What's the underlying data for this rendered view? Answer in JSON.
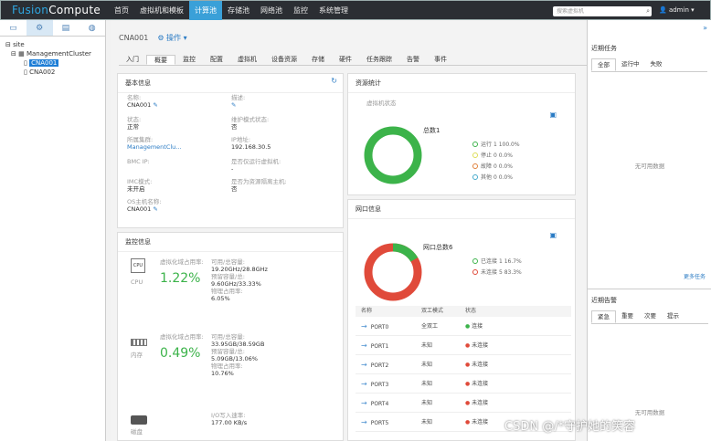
{
  "topbar": {
    "logo_a": "Fusion",
    "logo_b": "Compute",
    "nav": [
      "首页",
      "虚拟机和模板",
      "计算池",
      "存储池",
      "网络池",
      "监控",
      "系统管理"
    ],
    "active_nav": 2,
    "search_placeholder": "搜索虚拟机",
    "user": "admin"
  },
  "tree": {
    "root": "site",
    "cluster": "ManagementCluster",
    "hosts": [
      "CNA001",
      "CNA002"
    ],
    "selected": "CNA001"
  },
  "main": {
    "breadcrumb": "CNA001",
    "operation": "操作",
    "tabs": [
      "入门",
      "概要",
      "监控",
      "配置",
      "虚拟机",
      "设备资源",
      "存储",
      "硬件",
      "任务跟踪",
      "告警",
      "事件"
    ],
    "active_tab": 1
  },
  "basic": {
    "title": "基本信息",
    "name_label": "名称:",
    "name": "CNA001",
    "desc_label": "描述:",
    "status_label": "状态:",
    "status": "正常",
    "maint_label": "维护模式状态:",
    "maint": "否",
    "cluster_label": "所属集群:",
    "cluster": "ManagementClu...",
    "ip_label": "IP地址:",
    "ip": "192.168.30.5",
    "bmc_label": "BMC IP:",
    "bmc": "",
    "vm_label": "是否仅运行虚拟机:",
    "vm": "-",
    "imc_label": "IMC模式:",
    "imc": "未开启",
    "gpu_label": "是否为资源隔离主机:",
    "gpu": "否",
    "os_label": "OS主机名称:",
    "os": "CNA001"
  },
  "monitor": {
    "title": "监控信息",
    "cpu": {
      "name": "CPU",
      "usage_label": "虚拟化域占用率:",
      "pct": "1.22%",
      "avail_label": "可用/总容量:",
      "avail": "19.20GHz/28.8GHz",
      "res_label": "预留容量/总:",
      "res": "9.60GHz/33.33%",
      "real_label": "物理占用率:",
      "real": "6.05%"
    },
    "mem": {
      "name": "内存",
      "usage_label": "虚拟化域占用率:",
      "pct": "0.49%",
      "avail_label": "可用/总容量:",
      "avail": "33.95GB/38.59GB",
      "res_label": "预留容量/总:",
      "res": "5.09GB/13.06%",
      "real_label": "物理占用率:",
      "real": "10.76%"
    },
    "disk": {
      "name": "磁盘",
      "rate_label": "I/O写入速率:",
      "rate": "177.00 KB/s"
    }
  },
  "resource": {
    "title": "资源统计",
    "vm_state": "虚拟机状态",
    "total": "总数1",
    "items": [
      {
        "label": "运行",
        "count": "1",
        "pct": "100.0%",
        "color": "#3cb34a"
      },
      {
        "label": "停止",
        "count": "0",
        "pct": "0.0%",
        "color": "#dddd55"
      },
      {
        "label": "故障",
        "count": "0",
        "pct": "0.0%",
        "color": "#e0803a"
      },
      {
        "label": "其他",
        "count": "0",
        "pct": "0.0%",
        "color": "#44aacc"
      }
    ]
  },
  "ports": {
    "title": "网口信息",
    "total": "网口总数6",
    "connected": "已连接",
    "connected_count": "1",
    "connected_pct": "16.7%",
    "disconnected": "未连接",
    "disconnected_count": "5",
    "disconnected_pct": "83.3%",
    "headers": [
      "名称",
      "双工模式",
      "状态"
    ],
    "rows": [
      {
        "name": "PORT0",
        "mode": "全双工",
        "state": "连接",
        "ok": true
      },
      {
        "name": "PORT1",
        "mode": "未知",
        "state": "未连接",
        "ok": false
      },
      {
        "name": "PORT2",
        "mode": "未知",
        "state": "未连接",
        "ok": false
      },
      {
        "name": "PORT3",
        "mode": "未知",
        "state": "未连接",
        "ok": false
      },
      {
        "name": "PORT4",
        "mode": "未知",
        "state": "未连接",
        "ok": false
      },
      {
        "name": "PORT5",
        "mode": "未知",
        "state": "未连接",
        "ok": false
      }
    ]
  },
  "right": {
    "tasks_title": "近期任务",
    "tasks_tabs": [
      "全部",
      "运行中",
      "失败"
    ],
    "empty": "无可用数据",
    "more": "更多任务",
    "alarms_title": "近期告警",
    "alarm_tabs": [
      "紧急",
      "重要",
      "次要",
      "提示"
    ],
    "alarm_empty": "无可用数据"
  },
  "watermark": "CSDN @/*守护她的笑容"
}
